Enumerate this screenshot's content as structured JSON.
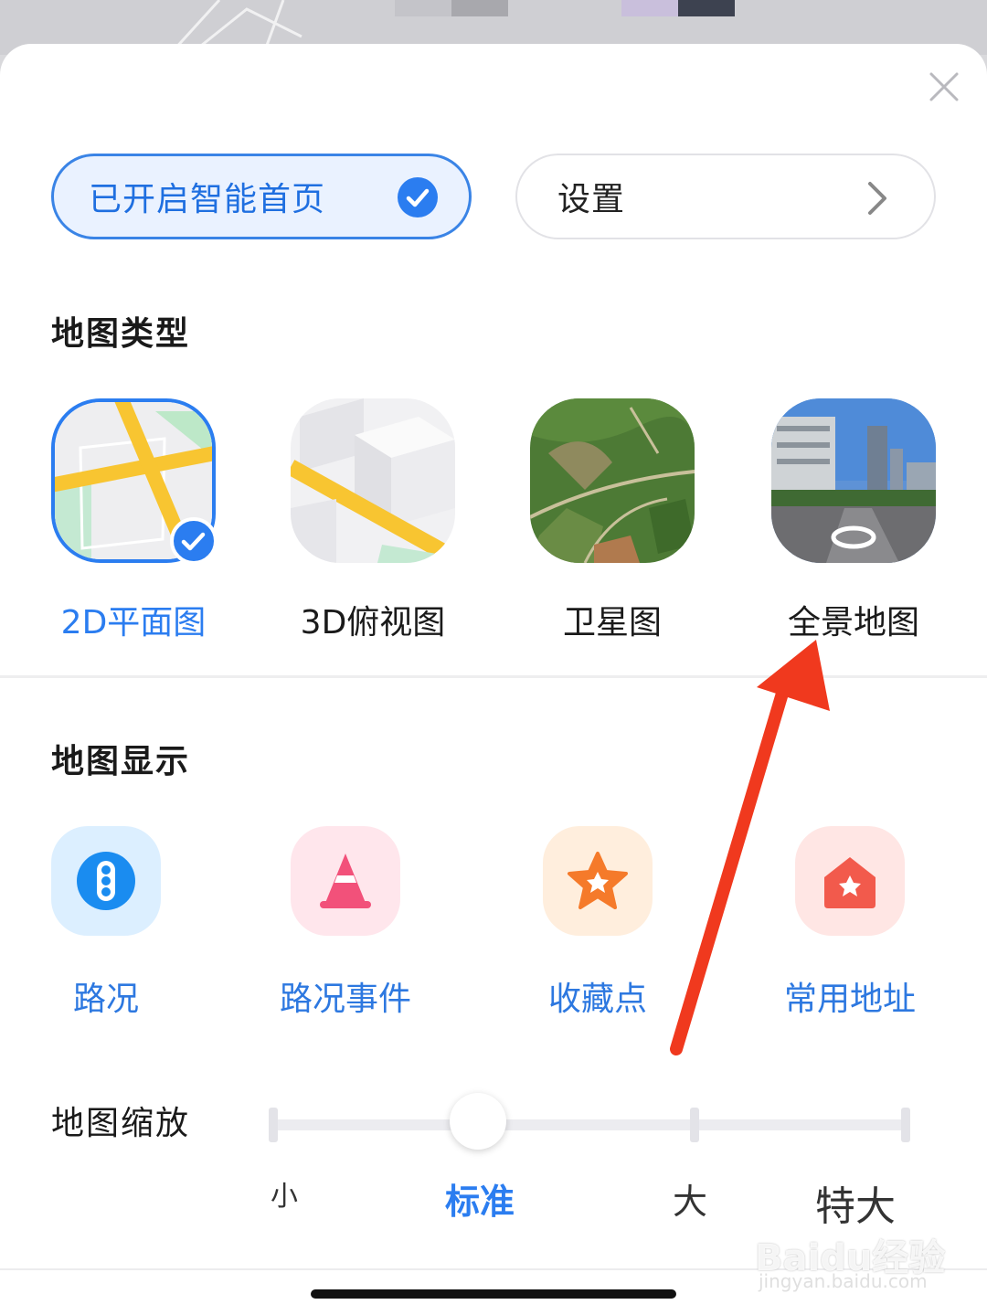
{
  "header": {
    "smart_home_label": "已开启智能首页",
    "settings_label": "设置"
  },
  "map_type": {
    "title": "地图类型",
    "items": [
      {
        "label": "2D平面图",
        "selected": true,
        "icon": "map-2d-icon"
      },
      {
        "label": "3D俯视图",
        "selected": false,
        "icon": "map-3d-icon"
      },
      {
        "label": "卫星图",
        "selected": false,
        "icon": "satellite-icon"
      },
      {
        "label": "全景地图",
        "selected": false,
        "icon": "panorama-icon"
      }
    ]
  },
  "map_display": {
    "title": "地图显示",
    "items": [
      {
        "label": "路况",
        "icon": "traffic-light-icon"
      },
      {
        "label": "路况事件",
        "icon": "traffic-cone-icon"
      },
      {
        "label": "收藏点",
        "icon": "star-icon"
      },
      {
        "label": "常用地址",
        "icon": "home-icon"
      }
    ]
  },
  "zoom": {
    "title": "地图缩放",
    "options": [
      "小",
      "标准",
      "大",
      "特大"
    ],
    "selected": "标准"
  },
  "watermark": {
    "brand": "Baidu经验",
    "url": "jingyan.baidu.com"
  },
  "colors": {
    "accent": "#2b7df0",
    "arrow": "#f0391e",
    "text_dark": "#1a1a1a"
  }
}
